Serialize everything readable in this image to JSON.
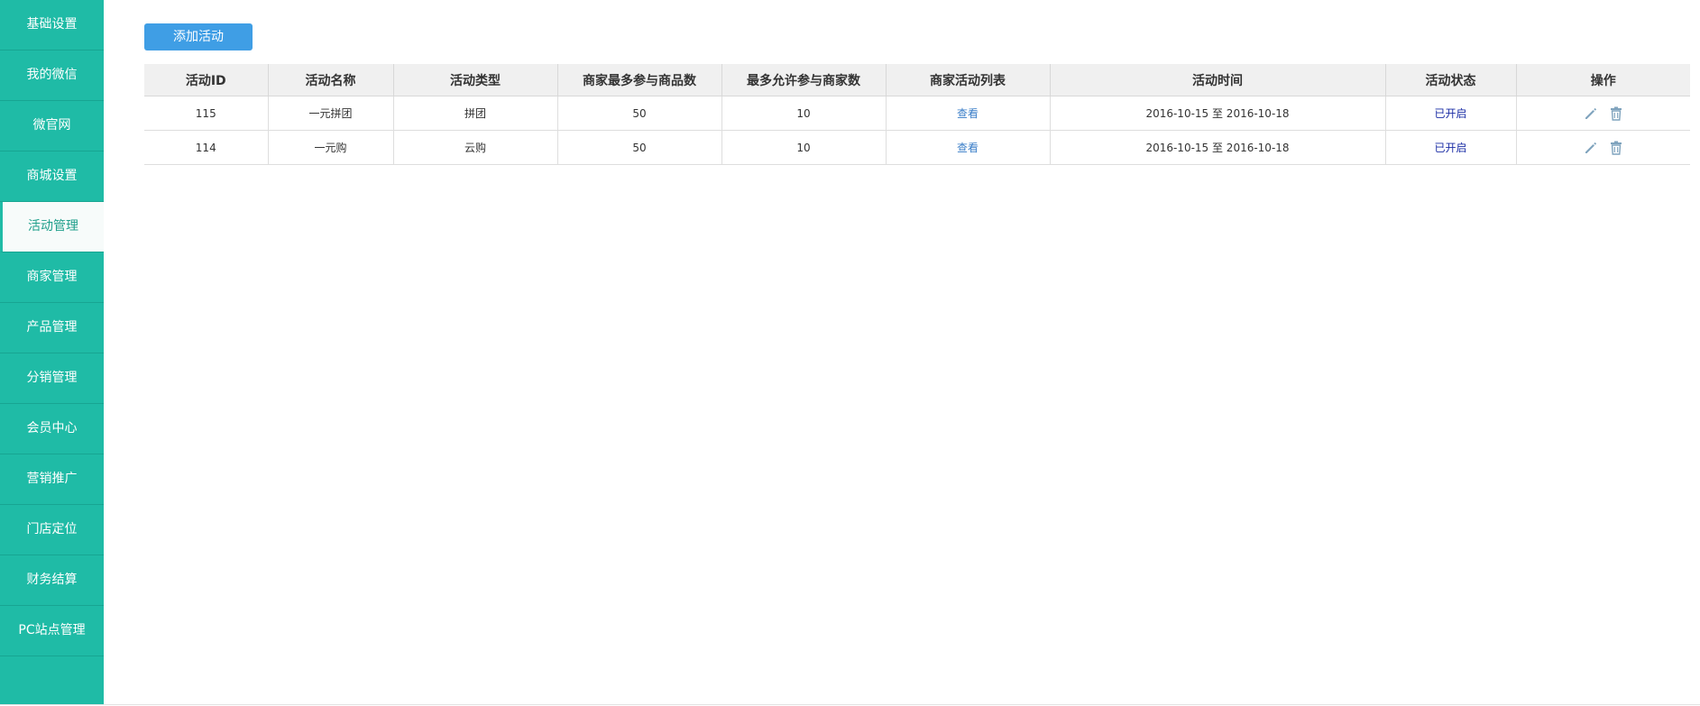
{
  "sidebar": {
    "items": [
      {
        "label": "基础设置"
      },
      {
        "label": "我的微信"
      },
      {
        "label": "微官网"
      },
      {
        "label": "商城设置"
      },
      {
        "label": "活动管理"
      },
      {
        "label": "商家管理"
      },
      {
        "label": "产品管理"
      },
      {
        "label": "分销管理"
      },
      {
        "label": "会员中心"
      },
      {
        "label": "营销推广"
      },
      {
        "label": "门店定位"
      },
      {
        "label": "财务结算"
      },
      {
        "label": "PC站点管理"
      }
    ],
    "active_index": 4
  },
  "toolbar": {
    "add_label": "添加活动"
  },
  "table": {
    "headers": [
      "活动ID",
      "活动名称",
      "活动类型",
      "商家最多参与商品数",
      "最多允许参与商家数",
      "商家活动列表",
      "活动时间",
      "活动状态",
      "操作"
    ],
    "rows": [
      {
        "id": "115",
        "name": "一元拼团",
        "type": "拼团",
        "max_goods": "50",
        "max_merchants": "10",
        "view": "查看",
        "time": "2016-10-15 至 2016-10-18",
        "status": "已开启"
      },
      {
        "id": "114",
        "name": "一元购",
        "type": "云购",
        "max_goods": "50",
        "max_merchants": "10",
        "view": "查看",
        "time": "2016-10-15 至 2016-10-18",
        "status": "已开启"
      }
    ]
  },
  "colors": {
    "sidebar_bg": "#1fbba6",
    "button_bg": "#3f9ee5",
    "link": "#3a7ec8",
    "status": "#1a2ca5",
    "icon": "#7fa3bd"
  },
  "icons": {
    "edit": "pencil-icon",
    "delete": "trash-icon"
  }
}
